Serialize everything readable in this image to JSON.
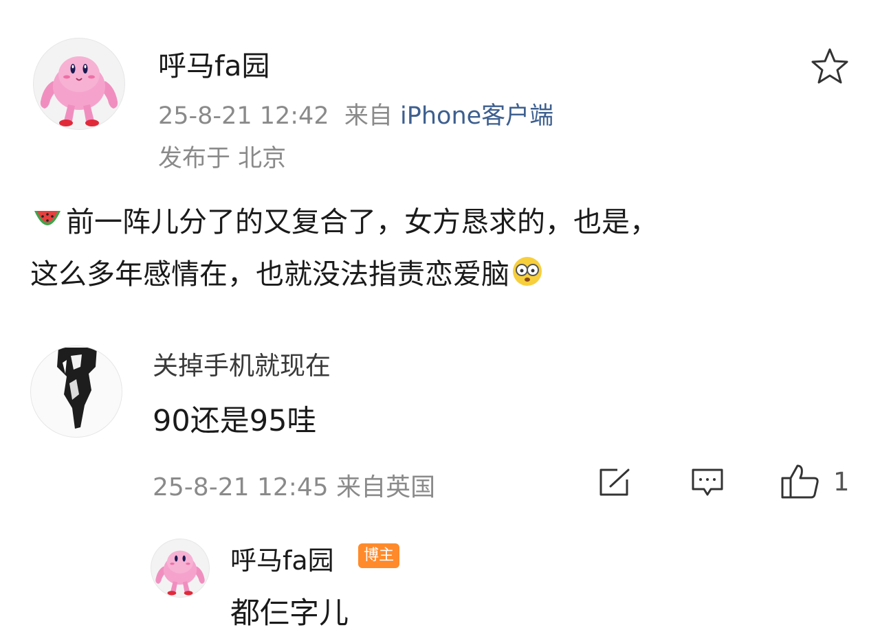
{
  "post": {
    "username": "呼马fa园",
    "avatar_icon": "muscular-pink-character-avatar",
    "timestamp": "25-8-21 12:42",
    "source_prefix": "来自",
    "source": "iPhone客户端",
    "location": "发布于 北京",
    "star_icon": "star-outline-icon",
    "body_line1": "前一阵儿分了的又复合了，女方恳求的，也是，",
    "body_line2": "这么多年感情在，也就没法指责恋爱脑",
    "emoji_leading": "watermelon-emoji",
    "emoji_trailing": "shocked-glasses-emoji"
  },
  "comment": {
    "username": "关掉手机就现在",
    "avatar_icon": "black-white-figure-avatar",
    "text": "90还是95哇",
    "timestamp": "25-8-21 12:45",
    "source": "来自英国",
    "like_count": "1"
  },
  "reply": {
    "username": "呼马fa园",
    "badge": "博主",
    "text": "都仨字儿"
  },
  "colors": {
    "badge": "#ff8a2b",
    "source_link": "#3d5f8f",
    "meta_gray": "#8a8a8a"
  }
}
